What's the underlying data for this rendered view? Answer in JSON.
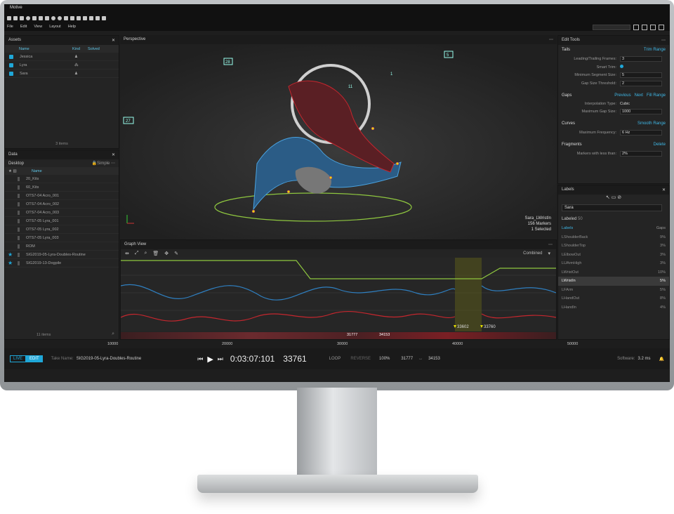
{
  "app": {
    "title": "Motive"
  },
  "menu": [
    "File",
    "Edit",
    "View",
    "Layout",
    "Help"
  ],
  "assets": {
    "title": "Assets",
    "cols": [
      "Name",
      "Kind",
      "Solved"
    ],
    "items": [
      "Jessica",
      "Lyra",
      "Sara"
    ],
    "footer": "3 items"
  },
  "data": {
    "title": "Data",
    "location": "Desktop",
    "mode": "Simple",
    "col": "Name",
    "items": [
      "20_Kits",
      "60_Kits",
      "OTS7-04 Acro_001",
      "OTS7-04 Acro_002",
      "OTS7-04 Acro_003",
      "OTS7-05 Lyra_001",
      "OTS7-05 Lyra_002",
      "OTS7-05 Lyra_003",
      "ROM",
      "SIG2019-05-Lyra-Doubles-Routine",
      "SIG2019-13-Dogpile"
    ],
    "starred": [
      9,
      10
    ],
    "footer": "11 items"
  },
  "viewport": {
    "title": "Perspective",
    "marker_labels": [
      "28",
      "5",
      "27",
      "1",
      "11",
      "1"
    ],
    "info": [
      "Sara_LWristIn",
      "156 Markers",
      "1 Selected"
    ]
  },
  "graph": {
    "title": "Graph View",
    "mode": "Combined",
    "markers": [
      "33602",
      "33760"
    ],
    "range_start": "31777",
    "range_end": "34153",
    "axis": [
      "10000",
      "20000",
      "30000",
      "40000",
      "50000"
    ]
  },
  "edit_tools": {
    "title": "Edit Tools",
    "tails": {
      "label": "Tails",
      "action": "Trim Range",
      "rows": [
        [
          "Leading/Trailing Frames:",
          "3"
        ],
        [
          "Smart Trim:",
          ""
        ],
        [
          "Minimum Segment Size:",
          "5"
        ],
        [
          "Gap Size Threshold:",
          "2"
        ]
      ]
    },
    "gaps": {
      "label": "Gaps",
      "prev": "Previous",
      "next": "Next",
      "action": "Fill Range",
      "rows": [
        [
          "Interpolation Type:",
          "Cubic"
        ],
        [
          "Maximum Gap Size:",
          "1000"
        ]
      ]
    },
    "curves": {
      "label": "Curves",
      "action": "Smooth Range",
      "rows": [
        [
          "Maximum Frequency:",
          "6 Hz"
        ]
      ]
    },
    "fragments": {
      "label": "Fragments",
      "action": "Delete",
      "rows": [
        [
          "Markers with less than:",
          "2%"
        ]
      ]
    }
  },
  "labels": {
    "title": "Labels",
    "asset": "Sara",
    "labeled": "Labeled",
    "labeled_count": "50",
    "col_labels": "Labels",
    "col_gaps": "Gaps",
    "items": [
      [
        "LShoulderBack",
        "9%"
      ],
      [
        "LShoulderTop",
        "3%"
      ],
      [
        "LElbowOut",
        "3%"
      ],
      [
        "LUArmHigh",
        "3%"
      ],
      [
        "LWristOut",
        "10%"
      ],
      [
        "LWristIn",
        "5%"
      ],
      [
        "LFArm",
        "5%"
      ],
      [
        "LHandOut",
        "8%"
      ],
      [
        "LHandIn",
        "4%"
      ]
    ],
    "selected": 5
  },
  "transport": {
    "live": "LIVE",
    "edit": "EDIT",
    "take_label": "Take Name:",
    "take": "SIG2019-05-Lyra-Doubles-Routine",
    "time": "0:03:07:101",
    "frame": "33761",
    "loop": "LOOP",
    "reverse": "REVERSE",
    "speed": "100%",
    "start": "31777",
    "end": "34153",
    "software_label": "Software:",
    "software_ms": "3.2 ms"
  },
  "colors": {
    "accent": "#1fa7d8",
    "green": "#8ec63f",
    "blue": "#2f7fc0",
    "red": "#c5262e",
    "yellow": "#e8e000"
  }
}
